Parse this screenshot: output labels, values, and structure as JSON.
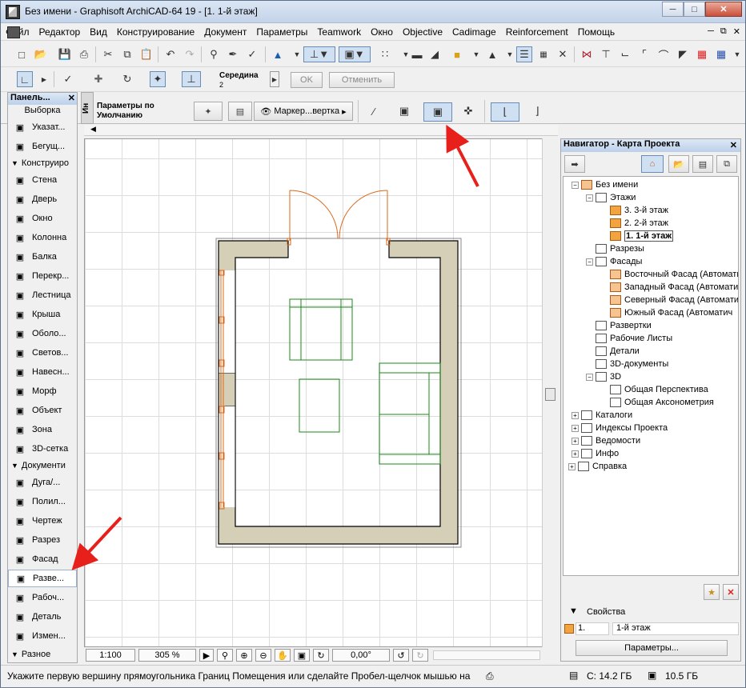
{
  "window": {
    "title": "Без имени - Graphisoft ArchiCAD-64 19 - [1. 1-й этаж]"
  },
  "menu": [
    "Файл",
    "Редактор",
    "Вид",
    "Конструирование",
    "Документ",
    "Параметры",
    "Teamwork",
    "Окно",
    "Objective",
    "Cadimage",
    "Reinforcement",
    "Помощь"
  ],
  "toolbar2": {
    "snap_label": "Середина",
    "snap_value": "2",
    "ok": "OK",
    "cancel": "Отменить"
  },
  "infobox": {
    "defaults_label": "Параметры по Умолчанию",
    "side_tab": "Ин",
    "marker_label": "Маркер...вертка"
  },
  "toolbox": {
    "title": "Панель...",
    "select_group": "Выборка",
    "select_items": [
      "Указат...",
      "Бегущ..."
    ],
    "design_group": "Конструиро",
    "design_items": [
      "Стена",
      "Дверь",
      "Окно",
      "Колонна",
      "Балка",
      "Перекр...",
      "Лестница",
      "Крыша",
      "Оболо...",
      "Светов...",
      "Навесн...",
      "Морф",
      "Объект",
      "Зона",
      "3D-сетка"
    ],
    "doc_group": "Документи",
    "doc_items": [
      "Дуга/...",
      "Полил...",
      "Чертеж",
      "Разрез",
      "Фасад",
      "Разве...",
      "Рабоч...",
      "Деталь",
      "Измен..."
    ],
    "misc_group": "Разное"
  },
  "navigator": {
    "title": "Навигатор - Карта Проекта",
    "tree": [
      {
        "label": "Без имени",
        "level": 0,
        "icon": "house",
        "exp": "-"
      },
      {
        "label": "Этажи",
        "level": 1,
        "icon": "folder",
        "exp": "-"
      },
      {
        "label": "3. 3-й этаж",
        "level": 2,
        "icon": "story"
      },
      {
        "label": "2. 2-й этаж",
        "level": 2,
        "icon": "story"
      },
      {
        "label": "1. 1-й этаж",
        "level": 2,
        "icon": "story",
        "current": true
      },
      {
        "label": "Разрезы",
        "level": 1,
        "icon": "view"
      },
      {
        "label": "Фасады",
        "level": 1,
        "icon": "view",
        "exp": "-"
      },
      {
        "label": "Восточный Фасад (Автомати",
        "level": 2,
        "icon": "house"
      },
      {
        "label": "Западный Фасад (Автомати",
        "level": 2,
        "icon": "house"
      },
      {
        "label": "Северный Фасад (Автомати",
        "level": 2,
        "icon": "house"
      },
      {
        "label": "Южный Фасад (Автоматич",
        "level": 2,
        "icon": "house"
      },
      {
        "label": "Развертки",
        "level": 1,
        "icon": "view"
      },
      {
        "label": "Рабочие Листы",
        "level": 1,
        "icon": "view"
      },
      {
        "label": "Детали",
        "level": 1,
        "icon": "view"
      },
      {
        "label": "3D-документы",
        "level": 1,
        "icon": "view"
      },
      {
        "label": "3D",
        "level": 1,
        "icon": "view",
        "exp": "-"
      },
      {
        "label": "Общая Перспектива",
        "level": 2,
        "icon": "camera"
      },
      {
        "label": "Общая Аксонометрия",
        "level": 2,
        "icon": "box"
      },
      {
        "label": "Каталоги",
        "level": 0,
        "icon": "view",
        "exp": "+"
      },
      {
        "label": "Индексы Проекта",
        "level": 0,
        "icon": "view",
        "exp": "+"
      },
      {
        "label": "Ведомости",
        "level": 0,
        "icon": "view",
        "exp": "+"
      },
      {
        "label": "Инфо",
        "level": 0,
        "icon": "view",
        "exp": "+"
      },
      {
        "label": "Справка",
        "level": -1,
        "icon": "view",
        "exp": "+"
      }
    ],
    "props_label": "Свойства",
    "props_num": "1.",
    "props_name": "1-й этаж",
    "params_button": "Параметры..."
  },
  "bottom": {
    "scale": "1:100",
    "zoom": "305 %",
    "angle": "0,00°"
  },
  "status": {
    "message": "Укажите первую вершину прямоугольника Границ Помещения или сделайте Пробел-щелчок мышью на",
    "disk_c": "С: 14.2 ГБ",
    "mem": "10.5 ГБ"
  },
  "colors": {
    "wall_fill": "#d6cfb7",
    "door_color": "#d9681a",
    "furniture": "#1a8a1a",
    "arrow": "#e8201c"
  }
}
